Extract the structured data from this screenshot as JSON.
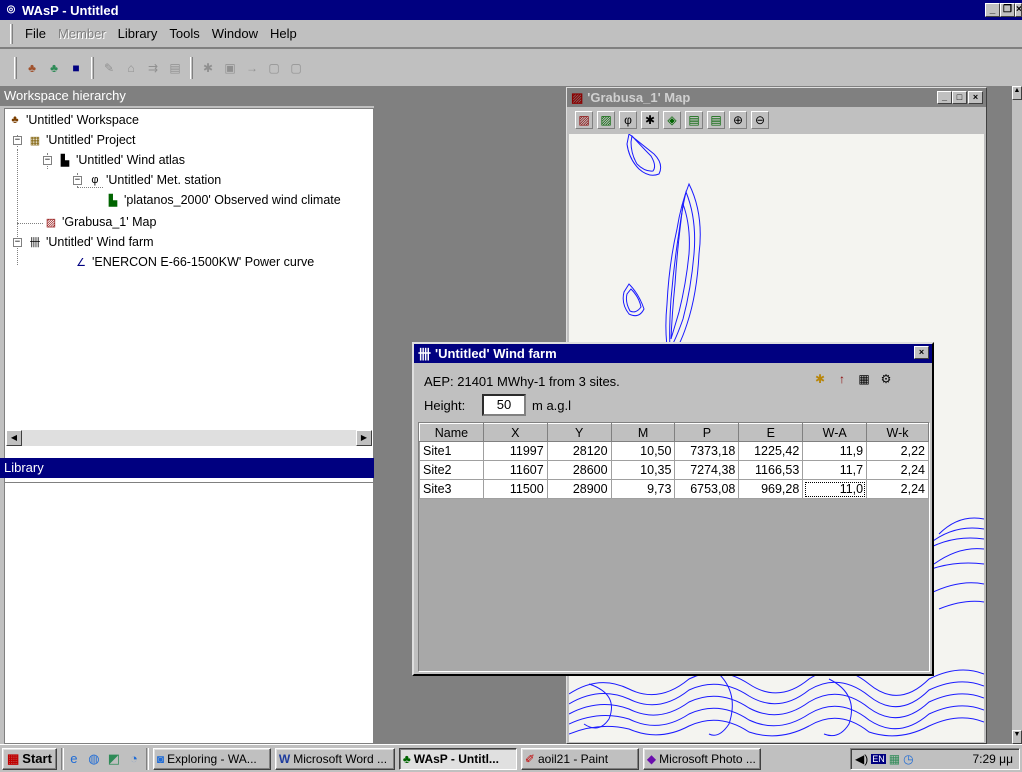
{
  "window": {
    "title": "WAsP - Untitled"
  },
  "menu": [
    "File",
    "Member",
    "Library",
    "Tools",
    "Window",
    "Help"
  ],
  "workspace": {
    "header": "Workspace hierarchy",
    "nodes": [
      {
        "label": "'Untitled' Workspace",
        "icon": "workspace-icon"
      },
      {
        "label": "'Untitled' Project",
        "icon": "project-icon"
      },
      {
        "label": "'Untitled' Wind atlas",
        "icon": "wind-atlas-icon"
      },
      {
        "label": "'Untitled' Met. station",
        "icon": "met-station-icon"
      },
      {
        "label": "'platanos_2000' Observed wind climate",
        "icon": "wind-climate-icon"
      },
      {
        "label": "'Grabusa_1' Map",
        "icon": "map-icon"
      },
      {
        "label": "'Untitled' Wind farm",
        "icon": "wind-farm-icon"
      },
      {
        "label": "'ENERCON E-66-1500KW' Power curve",
        "icon": "power-curve-icon"
      }
    ]
  },
  "library": {
    "header": "Library"
  },
  "map_window": {
    "title": "'Grabusa_1' Map"
  },
  "wind_farm": {
    "title": "'Untitled' Wind farm",
    "aep": "AEP: 21401 MWhy-1 from 3 sites.",
    "height_label": "Height:",
    "height_value": "50",
    "height_unit": "m a.g.l",
    "columns": [
      "Name",
      "X",
      "Y",
      "M",
      "P",
      "E",
      "W-A",
      "W-k"
    ],
    "rows": [
      [
        "Site1",
        "11997",
        "28120",
        "10,50",
        "7373,18",
        "1225,42",
        "11,9",
        "2,22"
      ],
      [
        "Site2",
        "11607",
        "28600",
        "10,35",
        "7274,38",
        "1166,53",
        "11,7",
        "2,24"
      ],
      [
        "Site3",
        "11500",
        "28900",
        "9,73",
        "6753,08",
        "969,28",
        "11,0",
        "2,24"
      ]
    ]
  },
  "taskbar": {
    "start": "Start",
    "tasks": [
      "Exploring - WA...",
      "Microsoft Word ...",
      "WAsP - Untitl...",
      "aoil21 - Paint",
      "Microsoft Photo ..."
    ],
    "clock": "7:29 μμ"
  },
  "colors": {
    "active_title": "#000080",
    "inactive_title": "#808080",
    "face": "#c0c0c0",
    "map_contour": "#1a1aff"
  }
}
